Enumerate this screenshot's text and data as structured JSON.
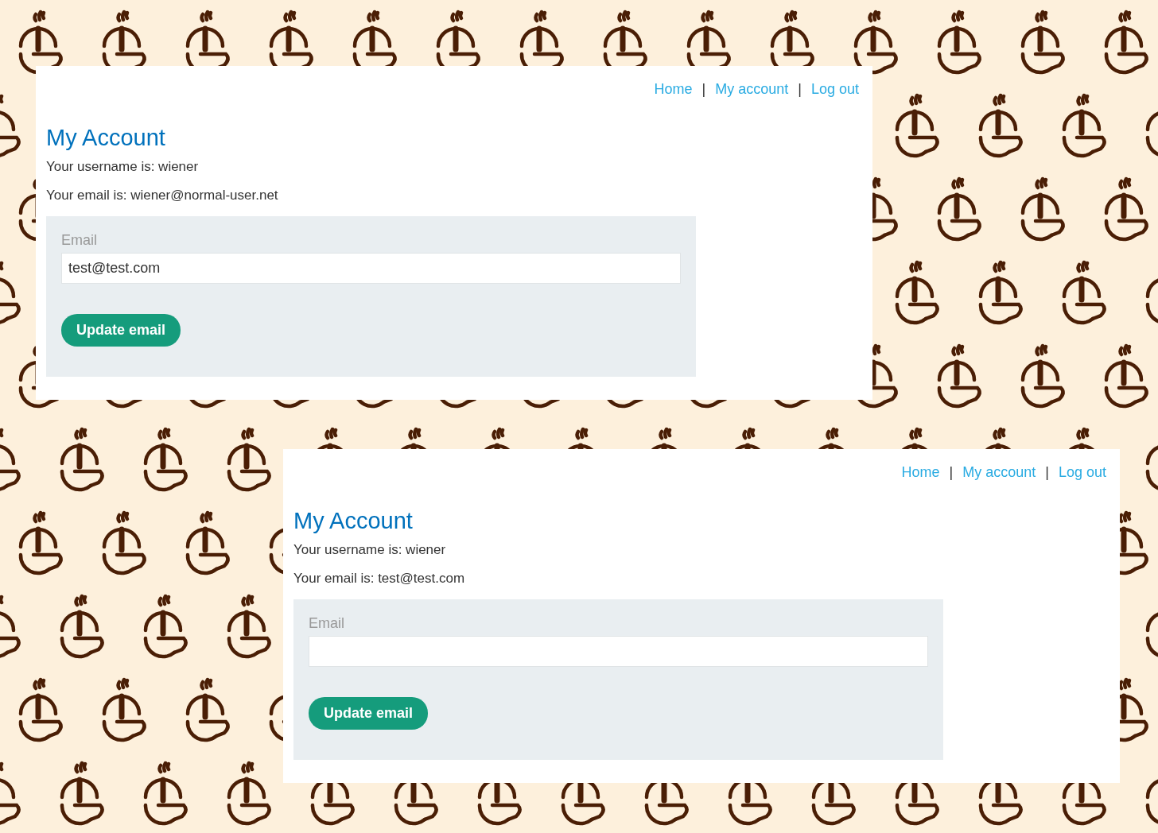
{
  "panels": [
    {
      "nav": [
        {
          "kind": "link",
          "text": "Home"
        },
        {
          "kind": "separator",
          "text": "|"
        },
        {
          "kind": "link",
          "text": "My account"
        },
        {
          "kind": "separator",
          "text": "|"
        },
        {
          "kind": "link",
          "text": "Log out"
        }
      ],
      "title": "My Account",
      "lines": [
        "Your username is: wiener",
        "Your email is: wiener@normal-user.net"
      ],
      "form": {
        "label": "Email",
        "value": "test@test.com",
        "button": "Update email"
      }
    },
    {
      "nav": [
        {
          "kind": "link",
          "text": "Home"
        },
        {
          "kind": "separator",
          "text": "|"
        },
        {
          "kind": "link",
          "text": "My account"
        },
        {
          "kind": "separator",
          "text": "|"
        },
        {
          "kind": "link",
          "text": "Log out"
        }
      ],
      "title": "My Account",
      "lines": [
        "Your username is: wiener",
        "Your email is: test@test.com"
      ],
      "form": {
        "label": "Email",
        "button": "Update email"
      }
    }
  ]
}
